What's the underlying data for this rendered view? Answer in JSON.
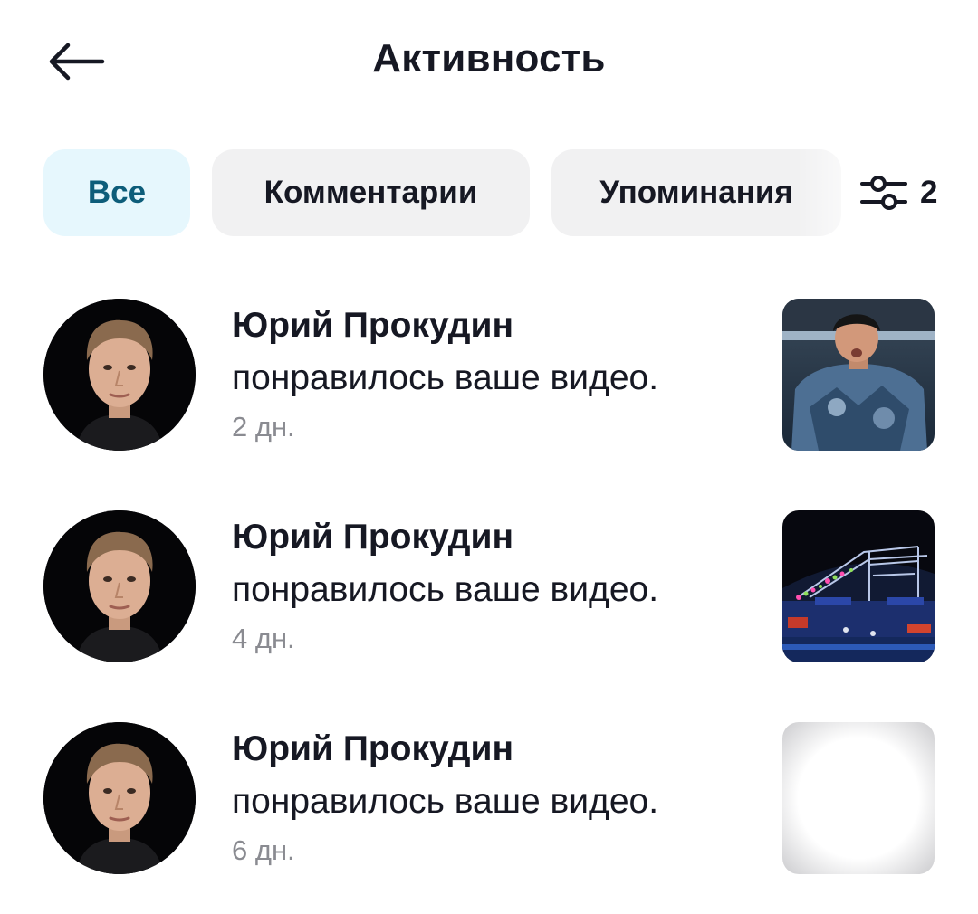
{
  "header": {
    "title": "Активность",
    "back_icon": "arrow-left-icon"
  },
  "filters": {
    "chips": [
      {
        "label": "Все",
        "active": true
      },
      {
        "label": "Комментарии",
        "active": false
      },
      {
        "label": "Упоминания",
        "active": false
      }
    ],
    "filter_icon": "sliders-icon",
    "filter_count": "2"
  },
  "notifications": [
    {
      "user": "Юрий Прокудин",
      "action": "понравилось ваше видео.",
      "time": "2 дн."
    },
    {
      "user": "Юрий Прокудин",
      "action": "понравилось ваше видео.",
      "time": "4 дн."
    },
    {
      "user": "Юрий Прокудин",
      "action": "понравилось ваше видео.",
      "time": "6 дн."
    }
  ],
  "colors": {
    "active_chip_bg": "#e6f7fd",
    "active_chip_text": "#0d5d7a",
    "chip_bg": "#f1f1f2",
    "secondary_text": "#8a8b91"
  }
}
